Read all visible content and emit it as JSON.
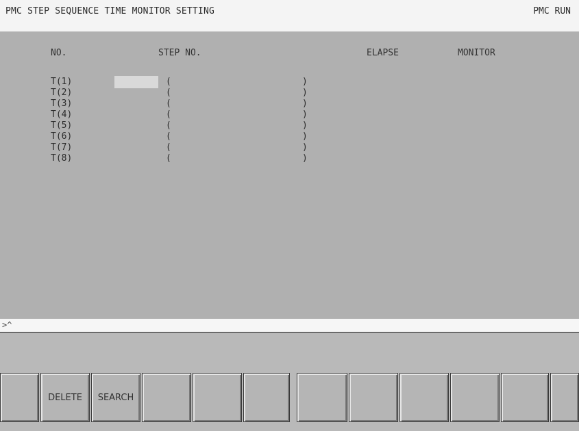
{
  "header": {
    "title": "PMC STEP SEQUENCE TIME MONITOR SETTING",
    "status": "PMC RUN"
  },
  "table": {
    "columns": {
      "no": "NO.",
      "step_no": "STEP NO.",
      "elapse": "ELAPSE",
      "monitor": "MONITOR"
    },
    "rows": [
      {
        "label": "T(1)",
        "open": "(",
        "close": ")"
      },
      {
        "label": "T(2)",
        "open": "(",
        "close": ")"
      },
      {
        "label": "T(3)",
        "open": "(",
        "close": ")"
      },
      {
        "label": "T(4)",
        "open": "(",
        "close": ")"
      },
      {
        "label": "T(5)",
        "open": "(",
        "close": ")"
      },
      {
        "label": "T(6)",
        "open": "(",
        "close": ")"
      },
      {
        "label": "T(7)",
        "open": "(",
        "close": ")"
      },
      {
        "label": "T(8)",
        "open": "(",
        "close": ")"
      }
    ]
  },
  "command_line": {
    "prompt": ">^"
  },
  "softkeys": [
    "",
    "DELETE",
    "SEARCH",
    "",
    "",
    "",
    "",
    "",
    "",
    "",
    "",
    ""
  ],
  "colors": {
    "screen_bg": "#b0b0b0",
    "header_bg": "#f4f4f4",
    "key_face": "#b5b5b5"
  }
}
